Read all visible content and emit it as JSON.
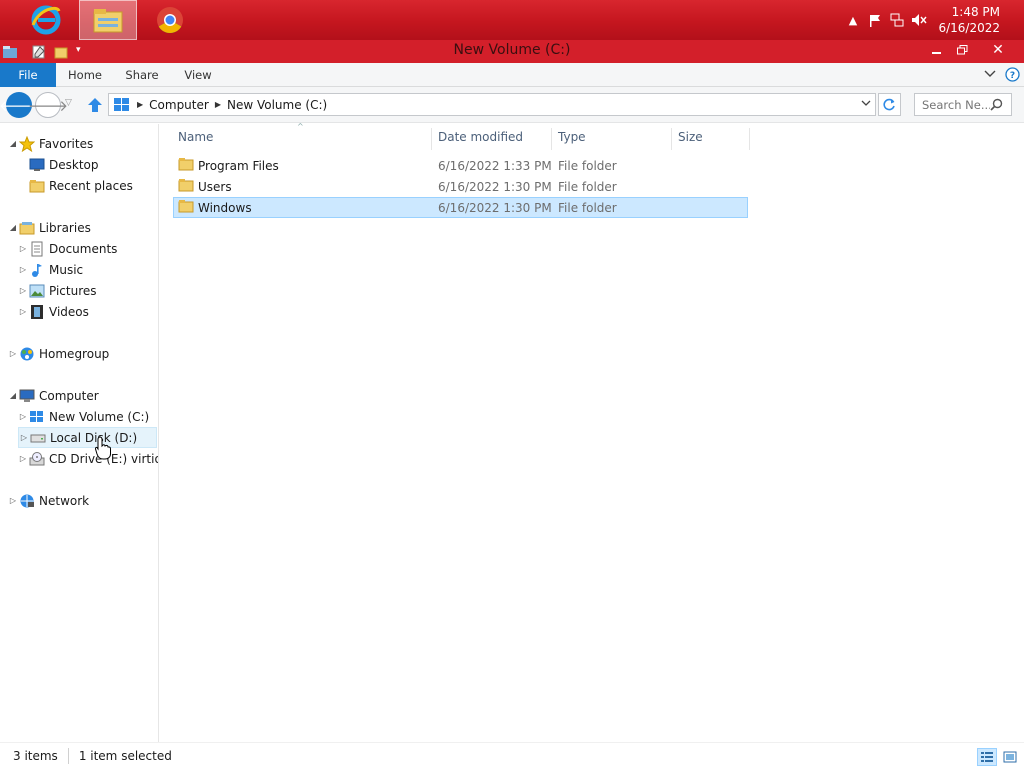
{
  "taskbar": {
    "apps": [
      {
        "name": "Internet Explorer",
        "icon": "internet-explorer-icon"
      },
      {
        "name": "File Explorer",
        "icon": "file-explorer-icon",
        "active": true
      },
      {
        "name": "Google Chrome",
        "icon": "chrome-icon"
      }
    ],
    "clock": {
      "time": "1:48 PM",
      "date": "6/16/2022"
    }
  },
  "window": {
    "title": "New Volume (C:)"
  },
  "ribbon": {
    "tabs": [
      "File",
      "Home",
      "Share",
      "View"
    ]
  },
  "address": {
    "breadcrumbs": [
      "Computer",
      "New Volume (C:)"
    ],
    "search_placeholder": "Search Ne..."
  },
  "navpane": {
    "favorites": {
      "label": "Favorites",
      "items": [
        "Desktop",
        "Recent places"
      ]
    },
    "libraries": {
      "label": "Libraries",
      "items": [
        "Documents",
        "Music",
        "Pictures",
        "Videos"
      ]
    },
    "homegroup": {
      "label": "Homegroup"
    },
    "computer": {
      "label": "Computer",
      "items": [
        "New Volume (C:)",
        "Local Disk (D:)",
        "CD Drive (E:) virtio-v"
      ]
    },
    "network": {
      "label": "Network"
    }
  },
  "filelist": {
    "columns": [
      "Name",
      "Date modified",
      "Type",
      "Size"
    ],
    "rows": [
      {
        "name": "Program Files",
        "date": "6/16/2022 1:33 PM",
        "type": "File folder",
        "size": ""
      },
      {
        "name": "Users",
        "date": "6/16/2022 1:30 PM",
        "type": "File folder",
        "size": ""
      },
      {
        "name": "Windows",
        "date": "6/16/2022 1:30 PM",
        "type": "File folder",
        "size": "",
        "selected": true
      }
    ]
  },
  "status": {
    "item_count": "3 items",
    "selection": "1 item selected"
  },
  "colors": {
    "taskbar": "#c5161f",
    "titlebar": "#d31f2a",
    "file_tab": "#1979ca",
    "selection": "#cce8ff",
    "selection_border": "#99d1ff"
  }
}
